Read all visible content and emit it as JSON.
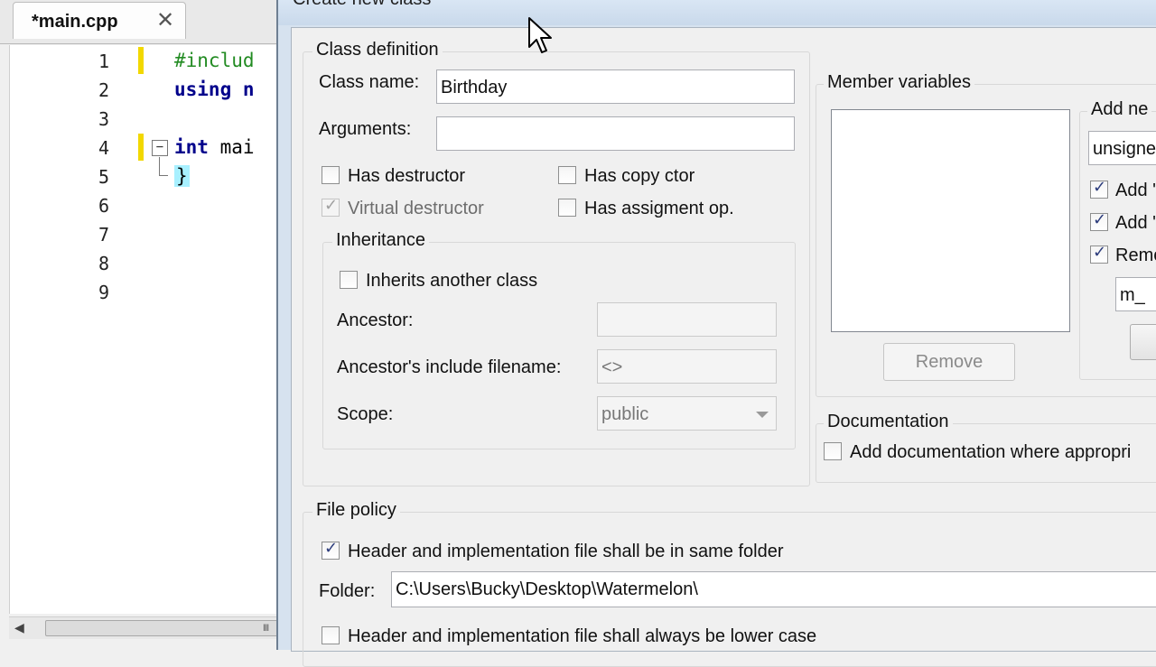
{
  "editor": {
    "tab_label": "*main.cpp",
    "close_glyph": "✕",
    "line_numbers": [
      "1",
      "2",
      "3",
      "4",
      "5",
      "6",
      "7",
      "8",
      "9"
    ],
    "code": {
      "line1": "#includ",
      "line2": "using n",
      "line4_kw": "int",
      "line4_rest": " mai",
      "line5": "}"
    },
    "fold_glyph": "−",
    "scroll_left_glyph": "◀",
    "scroll_grip": "III"
  },
  "dialog": {
    "title": "Create new class",
    "class_definition": {
      "group_title": "Class definition",
      "class_name_label": "Class name:",
      "class_name_value": "Birthday",
      "arguments_label": "Arguments:",
      "arguments_value": "",
      "has_destructor": "Has destructor",
      "virtual_destructor": "Virtual destructor",
      "has_copy_ctor": "Has copy ctor",
      "has_assignment_op": "Has assigment op."
    },
    "inheritance": {
      "group_title": "Inheritance",
      "inherits_label": "Inherits another class",
      "ancestor_label": "Ancestor:",
      "ancestor_value": "",
      "ancestor_include_label": "Ancestor's include filename:",
      "ancestor_include_value": "<>",
      "scope_label": "Scope:",
      "scope_value": "public"
    },
    "member_variables": {
      "group_title": "Member variables",
      "remove_button": "Remove",
      "add_new_title": "Add ne",
      "type_value": "unsigne",
      "check1": "Add '",
      "check2": "Add '",
      "check3": "Remo",
      "prefix_value": "m_"
    },
    "documentation": {
      "group_title": "Documentation",
      "checkbox_label": "Add documentation where appropri"
    },
    "file_policy": {
      "group_title": "File policy",
      "same_folder_label": "Header and implementation file shall be in same folder",
      "folder_label": "Folder:",
      "folder_value": "C:\\Users\\Bucky\\Desktop\\Watermelon\\",
      "lower_case_label": "Header and implementation file shall always be lower case"
    },
    "check_glyph": "✓"
  }
}
